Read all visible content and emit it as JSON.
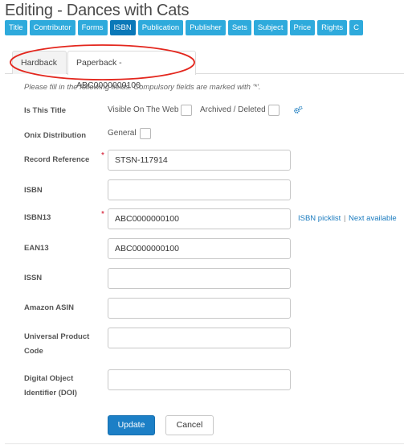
{
  "page": {
    "title": "Editing - Dances with Cats"
  },
  "nav": {
    "tabs": [
      {
        "label": "Title",
        "active": false
      },
      {
        "label": "Contributor",
        "active": false
      },
      {
        "label": "Forms",
        "active": false
      },
      {
        "label": "ISBN",
        "active": true
      },
      {
        "label": "Publication",
        "active": false
      },
      {
        "label": "Publisher",
        "active": false
      },
      {
        "label": "Sets",
        "active": false
      },
      {
        "label": "Subject",
        "active": false
      },
      {
        "label": "Price",
        "active": false
      },
      {
        "label": "Rights",
        "active": false
      },
      {
        "label": "C",
        "active": false
      }
    ]
  },
  "format_tabs": {
    "hardback": "Hardback",
    "paperback": "Paperback - ABC0000000100"
  },
  "form": {
    "info": "Please fill in the following fields. Compulsory fields are marked with '*'.",
    "is_this_title": {
      "label": "Is This Title",
      "visible_on_web": "Visible On The Web",
      "archived_deleted": "Archived / Deleted"
    },
    "onix_distribution": {
      "label": "Onix Distribution",
      "general": "General"
    },
    "record_reference": {
      "label": "Record Reference",
      "value": "STSN-117914",
      "required": "*"
    },
    "isbn": {
      "label": "ISBN",
      "value": ""
    },
    "isbn13": {
      "label": "ISBN13",
      "value": "ABC0000000100",
      "required": "*",
      "picklist": "ISBN picklist",
      "separator": "|",
      "next_available": "Next available"
    },
    "ean13": {
      "label": "EAN13",
      "value": "ABC0000000100"
    },
    "issn": {
      "label": "ISSN",
      "value": ""
    },
    "amazon_asin": {
      "label": "Amazon ASIN",
      "value": ""
    },
    "upc": {
      "label": "Universal Product Code",
      "value": ""
    },
    "doi": {
      "label": "Digital Object Identifier (DOI)",
      "value": ""
    }
  },
  "buttons": {
    "update": "Update",
    "cancel": "Cancel"
  },
  "colors": {
    "tab": "#2eaadc",
    "tab_active": "#0a78b8",
    "primary_button": "#1c7fc6",
    "required": "#d0021b",
    "annotation": "#e3261d",
    "link": "#1a7bbf"
  }
}
